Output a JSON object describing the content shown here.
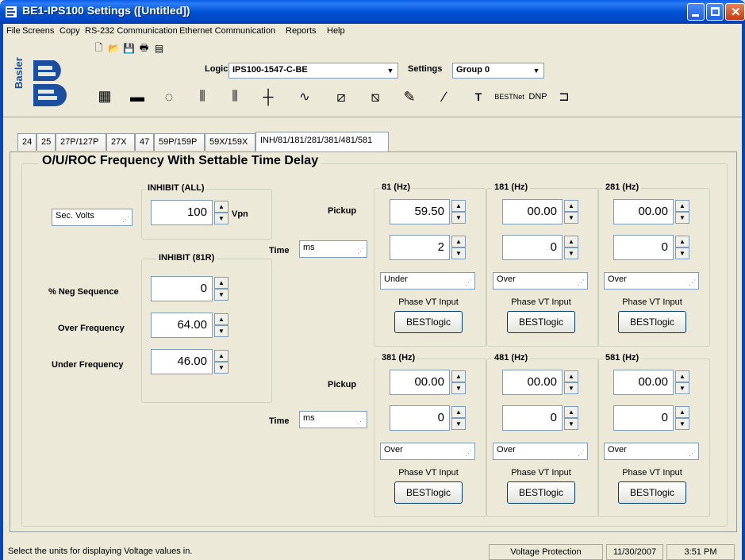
{
  "window": {
    "title": "BE1-IPS100 Settings   ([Untitled])"
  },
  "menu": {
    "items": [
      "File",
      "Screens",
      "Copy",
      "RS-232 Communication",
      "Ethernet Communication",
      "Reports",
      "Help"
    ]
  },
  "toolbar": {
    "logic_label": "Logic",
    "logic_value": "IPS100-1547-C-BE",
    "settings_label": "Settings",
    "settings_value": "Group 0",
    "logo_text": "Basler",
    "bestnet_label": "BESTNet",
    "dnp_label": "DNP"
  },
  "tabs": [
    {
      "label": "24"
    },
    {
      "label": "25"
    },
    {
      "label": "27P/127P"
    },
    {
      "label": "27X"
    },
    {
      "label": "47"
    },
    {
      "label": "59P/159P"
    },
    {
      "label": "59X/159X"
    },
    {
      "label": "INH/81/181/281/381/481/581",
      "active": true
    }
  ],
  "panel": {
    "title": "O/U/ROC Frequency With Settable Time Delay",
    "voltage_units": "Sec. Volts",
    "inhibit_all": {
      "label": "INHIBIT (ALL)",
      "value": "100",
      "unit": "Vpn"
    },
    "inhibit_81r": {
      "label": "INHIBIT (81R)",
      "neg_seq_label": "% Neg Sequence",
      "neg_seq_value": "0",
      "over_freq_label": "Over Frequency",
      "over_freq_value": "64.00",
      "under_freq_label": "Under Frequency",
      "under_freq_value": "46.00"
    },
    "pickup_label": "Pickup",
    "time_label": "Time",
    "time_unit_top": "ms",
    "time_unit_bottom": "ms",
    "elements": [
      {
        "label": "81 (Hz)",
        "pickup": "59.50",
        "time": "2",
        "mode": "Under",
        "input": "Phase VT Input",
        "button": "BESTlogic"
      },
      {
        "label": "181 (Hz)",
        "pickup": "00.00",
        "time": "0",
        "mode": "Over",
        "input": "Phase VT Input",
        "button": "BESTlogic"
      },
      {
        "label": "281 (Hz)",
        "pickup": "00.00",
        "time": "0",
        "mode": "Over",
        "input": "Phase VT Input",
        "button": "BESTlogic"
      },
      {
        "label": "381 (Hz)",
        "pickup": "00.00",
        "time": "0",
        "mode": "Over",
        "input": "Phase VT Input",
        "button": "BESTlogic"
      },
      {
        "label": "481 (Hz)",
        "pickup": "00.00",
        "time": "0",
        "mode": "Over",
        "input": "Phase VT Input",
        "button": "BESTlogic"
      },
      {
        "label": "581 (Hz)",
        "pickup": "00.00",
        "time": "0",
        "mode": "Over",
        "input": "Phase VT Input",
        "button": "BESTlogic"
      }
    ]
  },
  "status": {
    "message": "Select the units for displaying Voltage values in.",
    "section": "Voltage Protection",
    "date": "11/30/2007",
    "time": "3:51 PM"
  },
  "colors": {
    "title_bar": "#0047c4",
    "face": "#ece9d8",
    "logo_blue": "#1a4fa0"
  }
}
